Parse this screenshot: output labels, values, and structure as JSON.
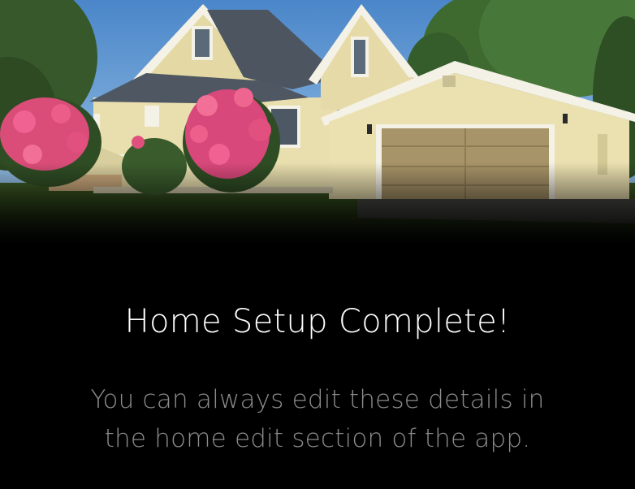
{
  "hero": {
    "image_label": "house-photo"
  },
  "completion": {
    "title": "Home Setup Complete!",
    "message_line_1": "You can always edit these details in",
    "message_line_2": "the home edit section of the app."
  },
  "colors": {
    "background": "#000000",
    "title_text": "#ffffff",
    "message_text": "#8c8c8c"
  }
}
